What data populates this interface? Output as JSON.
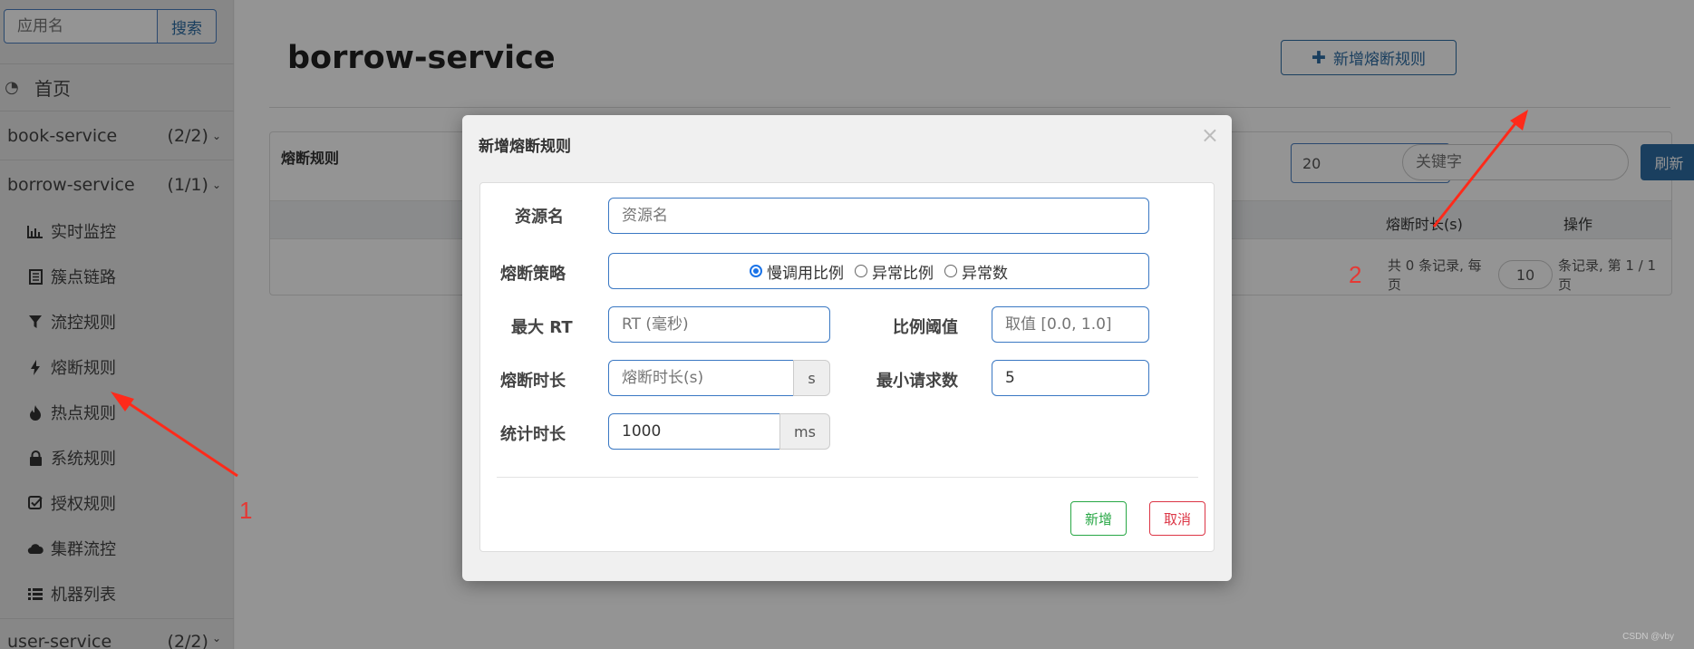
{
  "sidebar": {
    "search_placeholder": "应用名",
    "search_button": "搜索",
    "home_label": "首页",
    "apps": [
      {
        "name": "book-service",
        "count": "(2/2)"
      },
      {
        "name": "borrow-service",
        "count": "(1/1)"
      },
      {
        "name": "user-service",
        "count": "(2/2)"
      }
    ],
    "items": [
      {
        "label": "实时监控",
        "icon": "bar-chart-icon"
      },
      {
        "label": "簇点链路",
        "icon": "list-doc-icon"
      },
      {
        "label": "流控规则",
        "icon": "filter-icon"
      },
      {
        "label": "熔断规则",
        "icon": "bolt-icon"
      },
      {
        "label": "热点规则",
        "icon": "fire-icon"
      },
      {
        "label": "系统规则",
        "icon": "lock-icon"
      },
      {
        "label": "授权规则",
        "icon": "check-square-icon"
      },
      {
        "label": "集群流控",
        "icon": "cloud-icon"
      },
      {
        "label": "机器列表",
        "icon": "list-icon"
      }
    ]
  },
  "main": {
    "title": "borrow-service",
    "add_button": "新增熔断规则",
    "panel_title": "熔断规则",
    "select_value": "20",
    "keyword_placeholder": "关键字",
    "refresh_button": "刷新",
    "columns": [
      "熔断时长(s)",
      "操作"
    ],
    "pager": {
      "prefix": "共 0 条记录, 每页",
      "page_size": "10",
      "suffix": "条记录, 第 1 / 1 页"
    }
  },
  "modal": {
    "title": "新增熔断规则",
    "close": "×",
    "fields": {
      "resource_label": "资源名",
      "resource_placeholder": "资源名",
      "strategy_label": "熔断策略",
      "strategies": [
        "慢调用比例",
        "异常比例",
        "异常数"
      ],
      "selected_strategy": "慢调用比例",
      "max_rt_label": "最大 RT",
      "max_rt_placeholder": "RT (毫秒)",
      "ratio_label": "比例阈值",
      "ratio_placeholder": "取值 [0.0, 1.0]",
      "duration_label": "熔断时长",
      "duration_placeholder": "熔断时长(s)",
      "duration_unit": "s",
      "min_req_label": "最小请求数",
      "min_req_value": "5",
      "stat_label": "统计时长",
      "stat_value": "1000",
      "stat_unit": "ms"
    },
    "ok_button": "新增",
    "cancel_button": "取消"
  },
  "annotations": {
    "one": "1",
    "two": "2",
    "color": "#e53935"
  },
  "watermark": "CSDN @vby"
}
